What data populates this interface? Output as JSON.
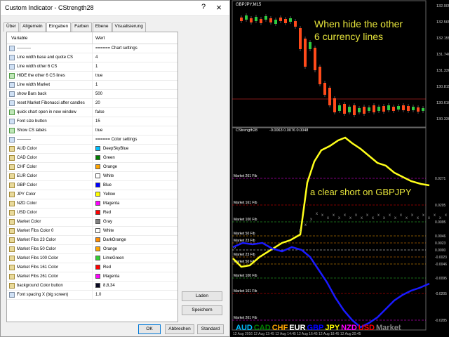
{
  "dialog": {
    "title": "Custom Indicator - CStrength28",
    "help_glyph": "?",
    "close_glyph": "×",
    "tabs": [
      {
        "label": "Über",
        "active": false
      },
      {
        "label": "Allgemein",
        "active": false
      },
      {
        "label": "Eingaben",
        "active": true
      },
      {
        "label": "Farben",
        "active": false
      },
      {
        "label": "Ebene",
        "active": false
      },
      {
        "label": "Visualisierung",
        "active": false
      }
    ],
    "grid": {
      "col_variable": "Variable",
      "col_value": "Wert",
      "rows": [
        {
          "icon": "abc",
          "label": "----------",
          "value": "====== Chart settings"
        },
        {
          "icon": "num",
          "label": "Line width base and quote CS",
          "value": "4"
        },
        {
          "icon": "num",
          "label": "Line width other 6 CS",
          "value": "1"
        },
        {
          "icon": "bool",
          "label": "HIDE the other 6 CS lines",
          "value": "true"
        },
        {
          "icon": "num",
          "label": "Line width Market",
          "value": "1"
        },
        {
          "icon": "num",
          "label": "show Bars back",
          "value": "500"
        },
        {
          "icon": "num",
          "label": "reset Market Fibonacci after candles",
          "value": "20"
        },
        {
          "icon": "bool",
          "label": "quick chart open in new window",
          "value": "false"
        },
        {
          "icon": "num",
          "label": "Font size button",
          "value": "15"
        },
        {
          "icon": "bool",
          "label": "Show CS labels",
          "value": "true"
        },
        {
          "icon": "abc",
          "label": "----------",
          "value": "====== Color settings"
        },
        {
          "icon": "color",
          "label": "AUD Color",
          "value": "DeepSkyBlue",
          "swatch": "#00bfff"
        },
        {
          "icon": "color",
          "label": "CAD Color",
          "value": "Green",
          "swatch": "#008000"
        },
        {
          "icon": "color",
          "label": "CHF Color",
          "value": "Orange",
          "swatch": "#ffa500"
        },
        {
          "icon": "color",
          "label": "EUR Color",
          "value": "White",
          "swatch": "#ffffff"
        },
        {
          "icon": "color",
          "label": "GBP Color",
          "value": "Blue",
          "swatch": "#0000ff"
        },
        {
          "icon": "color",
          "label": "JPY Color",
          "value": "Yellow",
          "swatch": "#ffff00"
        },
        {
          "icon": "color",
          "label": "NZD Color",
          "value": "Magenta",
          "swatch": "#ff00ff"
        },
        {
          "icon": "color",
          "label": "USD Color",
          "value": "Red",
          "swatch": "#ff0000"
        },
        {
          "icon": "color",
          "label": "Market Color",
          "value": "Gray",
          "swatch": "#808080"
        },
        {
          "icon": "color",
          "label": "Market Fibs Color 0",
          "value": "White",
          "swatch": "#ffffff"
        },
        {
          "icon": "color",
          "label": "Market Fibs 23 Color",
          "value": "DarkOrange",
          "swatch": "#ff8c00"
        },
        {
          "icon": "color",
          "label": "Market Fibs 50 Color",
          "value": "Orange",
          "swatch": "#ffa500"
        },
        {
          "icon": "color",
          "label": "Market Fibs 100 Color",
          "value": "LimeGreen",
          "swatch": "#32cd32"
        },
        {
          "icon": "color",
          "label": "Market Fibs 161 Color",
          "value": "Red",
          "swatch": "#ff0000"
        },
        {
          "icon": "color",
          "label": "Market Fibs 261 Color",
          "value": "Magenta",
          "swatch": "#ff00ff"
        },
        {
          "icon": "color",
          "label": "background Color button",
          "value": "8,8,34",
          "swatch": "#080822"
        },
        {
          "icon": "num",
          "label": "Font spacing X (big screen)",
          "value": "1.0"
        }
      ]
    },
    "buttons": {
      "load": "Laden",
      "save": "Speichern",
      "ok": "OK",
      "cancel": "Abbrechen",
      "default": "Standard"
    }
  },
  "chart": {
    "price_title": "GBPJPY,M15",
    "price_annotation_line1": "When hide the other",
    "price_annotation_line2": "6 currency lines",
    "price_axis": [
      "132.905",
      "132.565",
      "132.155",
      "131.740",
      "131.330",
      "130.815",
      "130.610",
      "130.330"
    ],
    "price_current": "130.815",
    "indicator_title": "CStrength28",
    "indicator_values": "-0.0063 0.0076 0.0048",
    "annotation": "a clear short on GBPJPY",
    "fib_levels": [
      {
        "label": "Market 261 Fib",
        "color": "#ff00ff"
      },
      {
        "label": "Market 161 Fib",
        "color": "#ff0000"
      },
      {
        "label": "Market 100 Fib",
        "color": "#32cd32"
      },
      {
        "label": "Market 50 Fib",
        "color": "#ffa500"
      },
      {
        "label": "Market 23 Fib",
        "color": "#ff8c00"
      },
      {
        "label": "0",
        "color": "#ffffff"
      },
      {
        "label": "Market 23 Fib",
        "color": "#ff8c00"
      },
      {
        "label": "Market 50 Fib",
        "color": "#ffa500"
      },
      {
        "label": "Market 100 Fib",
        "color": "#32cd32"
      },
      {
        "label": "Market 161 Fib",
        "color": "#ff0000"
      },
      {
        "label": "Market 261 Fib",
        "color": "#ff00ff"
      }
    ],
    "indicator_axis": [
      "0.0271",
      "0.0205",
      "0.0095",
      "0.0046",
      "0.0023",
      "0.0000",
      "-0.0023",
      "-0.0046",
      "-0.0095",
      "-0.0205",
      "-0.0285"
    ],
    "currency_buttons": [
      {
        "label": "AUD",
        "color": "#00bfff"
      },
      {
        "label": "CAD",
        "color": "#008000"
      },
      {
        "label": "CHF",
        "color": "#ffa500"
      },
      {
        "label": "EUR",
        "color": "#ffffff"
      },
      {
        "label": "GBP",
        "color": "#0000ff"
      },
      {
        "label": "JPY",
        "color": "#ffff00"
      },
      {
        "label": "NZD",
        "color": "#ff00ff"
      },
      {
        "label": "USD",
        "color": "#ff0000"
      },
      {
        "label": "Market",
        "color": "#808080"
      }
    ],
    "time_axis": "12 Aug 2016   12 Aug 12:45   12 Aug 14:45   12 Aug 16:45   12 Aug 18:45   12 Aug 20:45"
  }
}
